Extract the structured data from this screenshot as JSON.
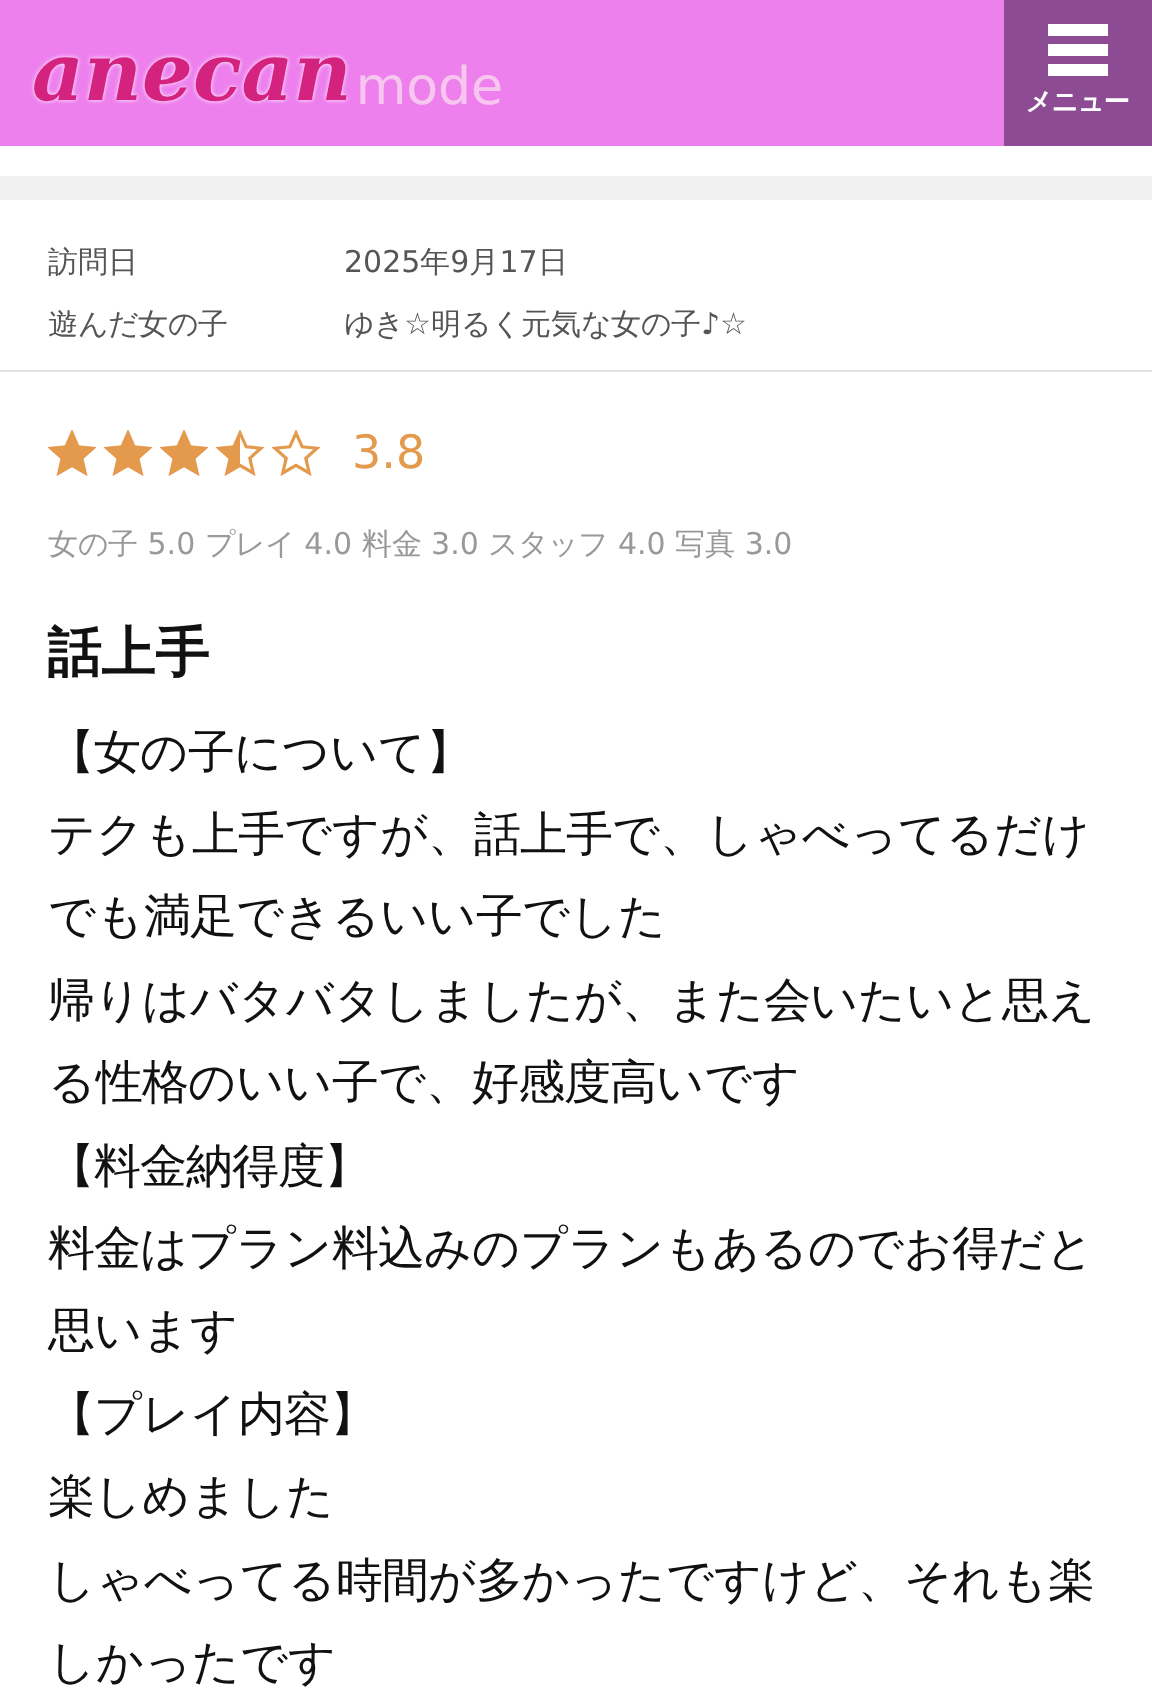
{
  "header": {
    "logo": {
      "main": "anecan",
      "sub": "mode"
    },
    "menu_label": "メニュー"
  },
  "info": [
    {
      "label": "訪問日",
      "value": "2025年9月17日"
    },
    {
      "label": "遊んだ女の子",
      "value": "ゆき☆明るく元気な女の子♪☆"
    }
  ],
  "rating": {
    "stars": 3.5,
    "score": "3.8",
    "breakdown": "女の子 5.0 プレイ 4.0 料金 3.0 スタッフ 4.0 写真 3.0"
  },
  "review": {
    "title": "話上手",
    "paragraphs": [
      "【女の子について】",
      "テクも上手ですが、話上手で、しゃべってるだけでも満足できるいい子でした",
      "帰りはバタバタしましたが、また会いたいと思える性格のいい子で、好感度高いです",
      "【料金納得度】",
      "料金はプラン料込みのプランもあるのでお得だと思います",
      "【プレイ内容】",
      "楽しめました",
      "しゃべってる時間が多かったですけど、それも楽しかったです"
    ]
  }
}
